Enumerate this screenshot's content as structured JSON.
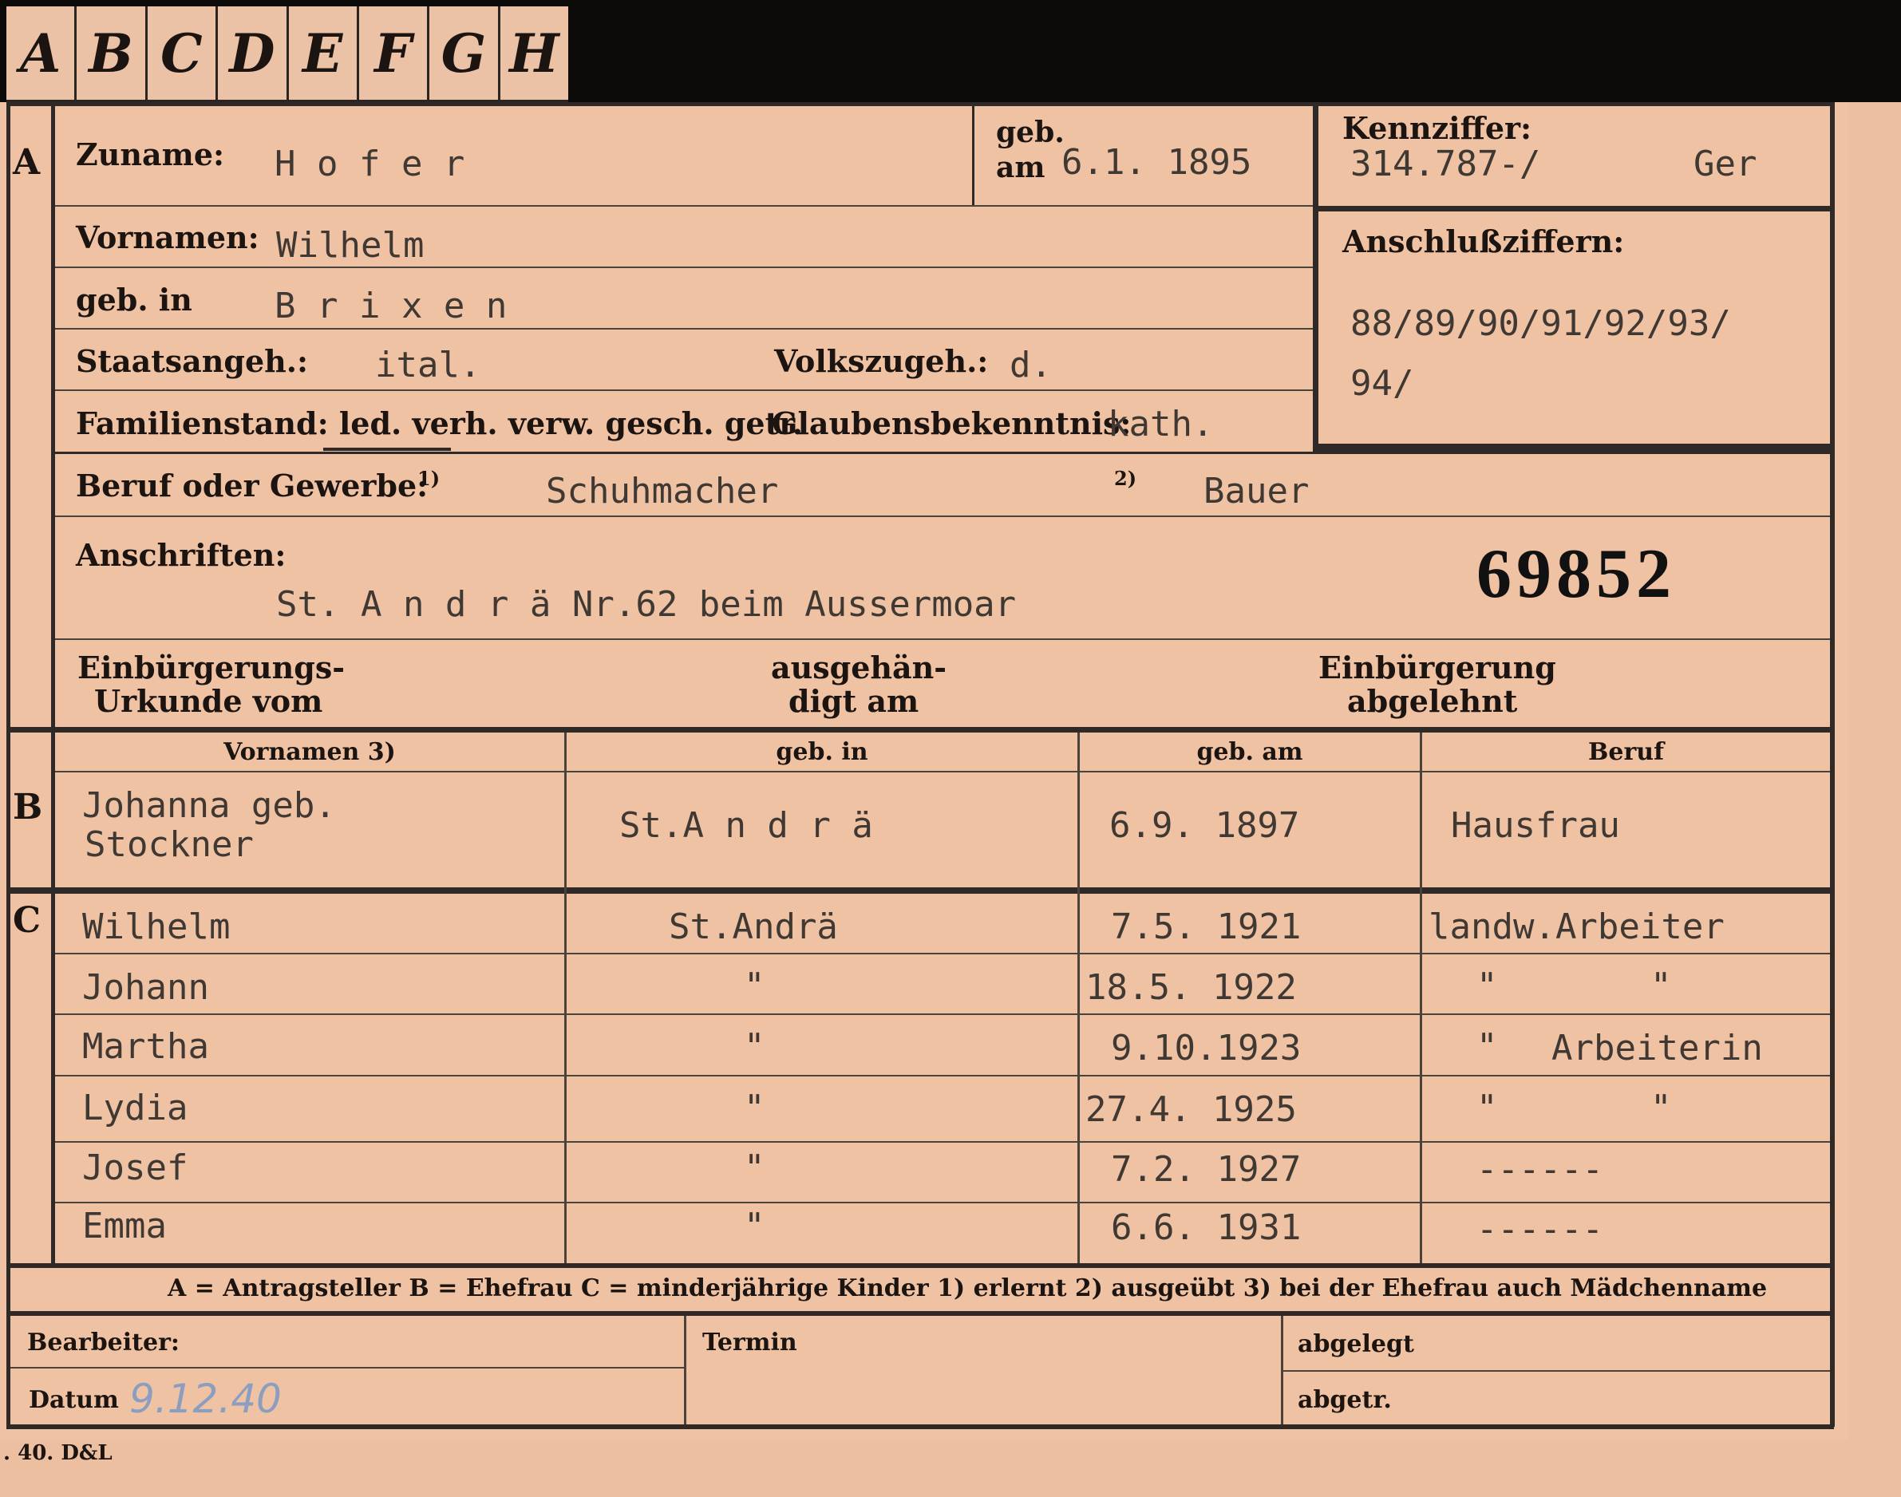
{
  "tabs": [
    "A",
    "B",
    "C",
    "D",
    "E",
    "F",
    "G",
    "H"
  ],
  "section_markers": {
    "a": "A",
    "b": "B",
    "c": "C"
  },
  "person": {
    "surname_label": "Zuname:",
    "surname": "H o f e r",
    "born_label_1": "geb.",
    "born_label_2": "am",
    "born_date": "6.1. 1895",
    "first_names_label": "Vornamen:",
    "first_names": "Wilhelm",
    "birthplace_label": "geb. in",
    "birthplace": "B r i x e n",
    "citizenship_label": "Staatsangeh.:",
    "citizenship": "ital.",
    "ethnicity_label": "Volkszugeh.:",
    "ethnicity": "d.",
    "marital_label": "Familienstand: led. verh. verw. gesch. getr.",
    "religion_label": "Glaubensbekenntnis:",
    "religion": "kath.",
    "occupation_label": "Beruf oder Gewerbe:",
    "occ_mark_1": "1)",
    "occupation_1": "Schuhmacher",
    "occ_mark_2": "2)",
    "occupation_2": "Bauer",
    "addresses_label": "Anschriften:",
    "address": "St. A n d r ä Nr.62 beim Aussermoar",
    "card_number": "69852"
  },
  "kennziffer": {
    "label": "Kennziffer:",
    "value": "314.787-/",
    "suffix": "Ger",
    "anschluss_label": "Anschlußziffern:",
    "anschluss_line1": "88/89/90/91/92/93/",
    "anschluss_line2": "94/"
  },
  "naturalization": {
    "col1_line1": "Einbürgerungs-",
    "col1_line2": "Urkunde vom",
    "col2_line1": "ausgehän-",
    "col2_line2": "digt am",
    "col3_line1": "Einbürgerung",
    "col3_line2": "abgelehnt"
  },
  "table_headers": {
    "vornamen": "Vornamen 3)",
    "geb_in": "geb. in",
    "geb_am": "geb. am",
    "beruf": "Beruf"
  },
  "spouse": {
    "name_line1": "Johanna geb.",
    "name_line2": "Stockner",
    "birthplace": "St.A n d r ä",
    "born": "6.9. 1897",
    "occupation": "Hausfrau"
  },
  "children": [
    {
      "name": "Wilhelm",
      "place": "St.Andrä",
      "born": "7.5. 1921",
      "occ_a": "landw.Arbeiter",
      "occ_b": ""
    },
    {
      "name": "Johann",
      "place": "\"",
      "born": "18.5. 1922",
      "occ_a": "\"",
      "occ_b": "\""
    },
    {
      "name": "Martha",
      "place": "\"",
      "born": "9.10.1923",
      "occ_a": "\"",
      "occ_b": "Arbeiterin"
    },
    {
      "name": "Lydia",
      "place": "\"",
      "born": "27.4. 1925",
      "occ_a": "\"",
      "occ_b": "\""
    },
    {
      "name": "Josef",
      "place": "\"",
      "born": "7.2. 1927",
      "occ_a": "------",
      "occ_b": ""
    },
    {
      "name": "Emma",
      "place": "\"",
      "born": "6.6. 1931",
      "occ_a": "------",
      "occ_b": ""
    }
  ],
  "legend": "A = Antragsteller   B = Ehefrau   C = minderjährige Kinder   1) erlernt   2) ausgeübt   3) bei der Ehefrau auch Mädchenname",
  "footer": {
    "bearbeiter_label": "Bearbeiter:",
    "datum_label": "Datum",
    "datum_value": "9.12.40",
    "termin_label": "Termin",
    "abgelegt_label": "abgelegt",
    "abgetr_label": "abgetr.",
    "print_mark": ". 40. D&L"
  }
}
